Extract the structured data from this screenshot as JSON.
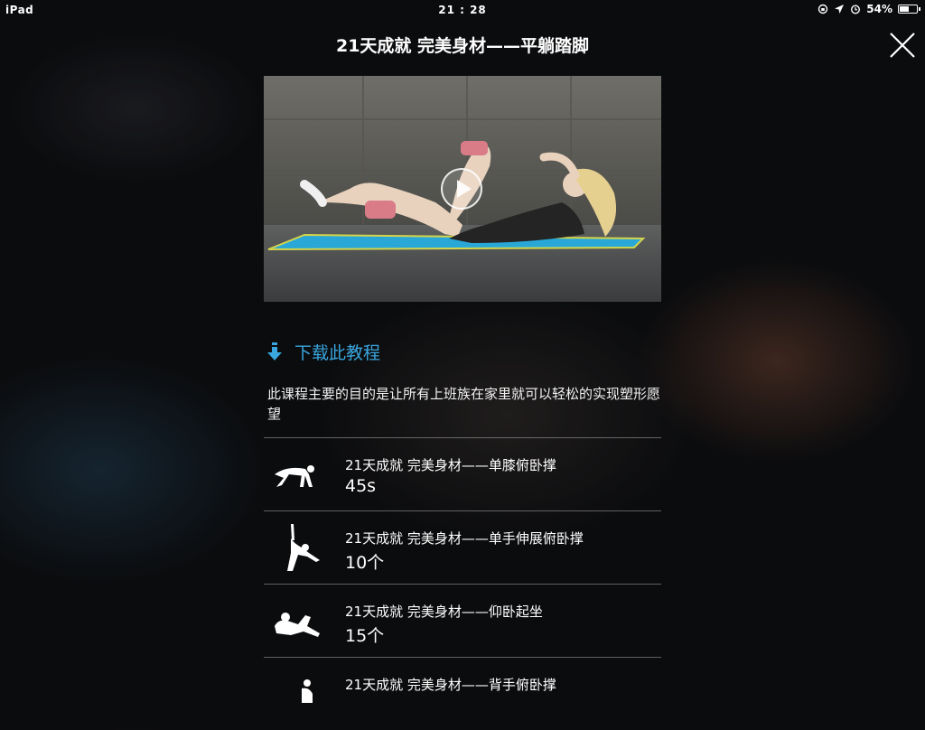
{
  "status_bar": {
    "device": "iPad",
    "time": "21 : 28",
    "battery_percent_label": "54%",
    "battery_level": 0.54
  },
  "header": {
    "title": "21天成就 完美身材——平躺踏脚"
  },
  "video": {
    "play_icon": "play-icon"
  },
  "download": {
    "label": "下载此教程",
    "icon": "download-arrow-icon"
  },
  "description": "此课程主要的目的是让所有上班族在家里就可以轻松的实现塑形愿望",
  "exercises": [
    {
      "title": "21天成就 完美身材——单膝俯卧撑",
      "value": "45s",
      "icon": "kneeling-pushup-icon"
    },
    {
      "title": "21天成就 完美身材——单手伸展俯卧撑",
      "value": "10个",
      "icon": "side-plank-reach-icon"
    },
    {
      "title": "21天成就 完美身材——仰卧起坐",
      "value": "15个",
      "icon": "situp-icon"
    },
    {
      "title": "21天成就 完美身材——背手俯卧撑",
      "value": "",
      "icon": "back-pushup-icon"
    }
  ],
  "colors": {
    "accent": "#39a6df",
    "background": "#0b0c0e"
  }
}
